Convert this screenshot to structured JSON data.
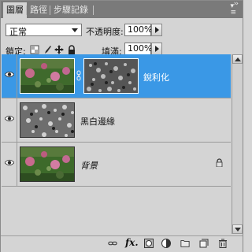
{
  "tabs": [
    {
      "label": "圖層"
    },
    {
      "label": "路徑"
    },
    {
      "label": "步驟記錄"
    }
  ],
  "blend_mode": {
    "value": "正常"
  },
  "opacity": {
    "label": "不透明度:",
    "value": "100%"
  },
  "lock": {
    "label": "鎖定:"
  },
  "fill": {
    "label": "填滿:",
    "value": "100%"
  },
  "layers": [
    {
      "name": "銳利化",
      "selected": true
    },
    {
      "name": "黑白邊緣",
      "selected": false
    },
    {
      "name": "背景",
      "selected": false,
      "locked": true
    }
  ],
  "colors": {
    "selection": "#3a98e6",
    "panel": "#d4d4d4",
    "tabbar": "#7a7a7a"
  }
}
